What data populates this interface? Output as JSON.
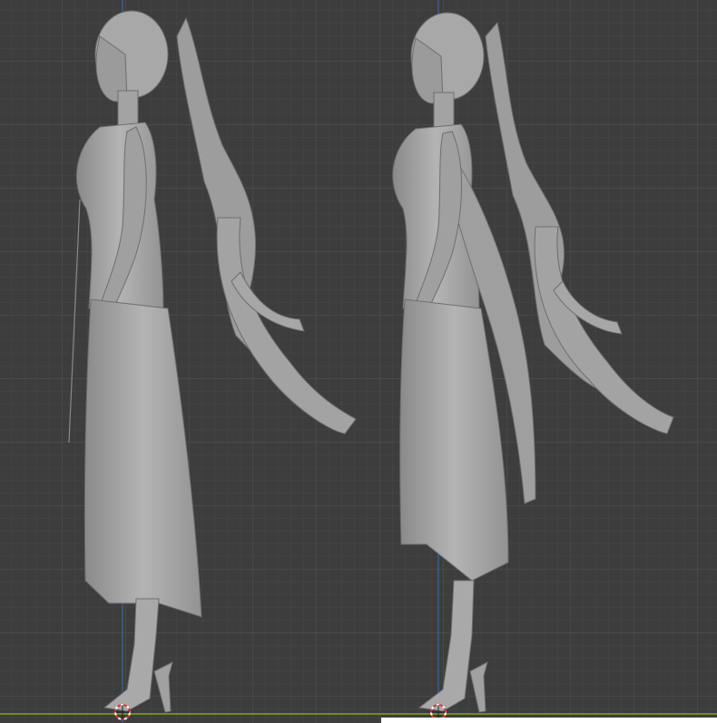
{
  "viewport": {
    "background": "#3d3d3d",
    "grid_minor_color": "#454545",
    "grid_major_color": "#4c4c4c",
    "z_axis_color": "#3a6ea8",
    "x_axis_color": "#6d8a2e",
    "model_color": "#a9a9a9",
    "model_shadow_color": "#6e6e6e",
    "cursor_icon": "3d-cursor-icon"
  },
  "models": [
    {
      "name": "character-side-view-left",
      "view": "side"
    },
    {
      "name": "character-side-view-right",
      "view": "side"
    }
  ]
}
